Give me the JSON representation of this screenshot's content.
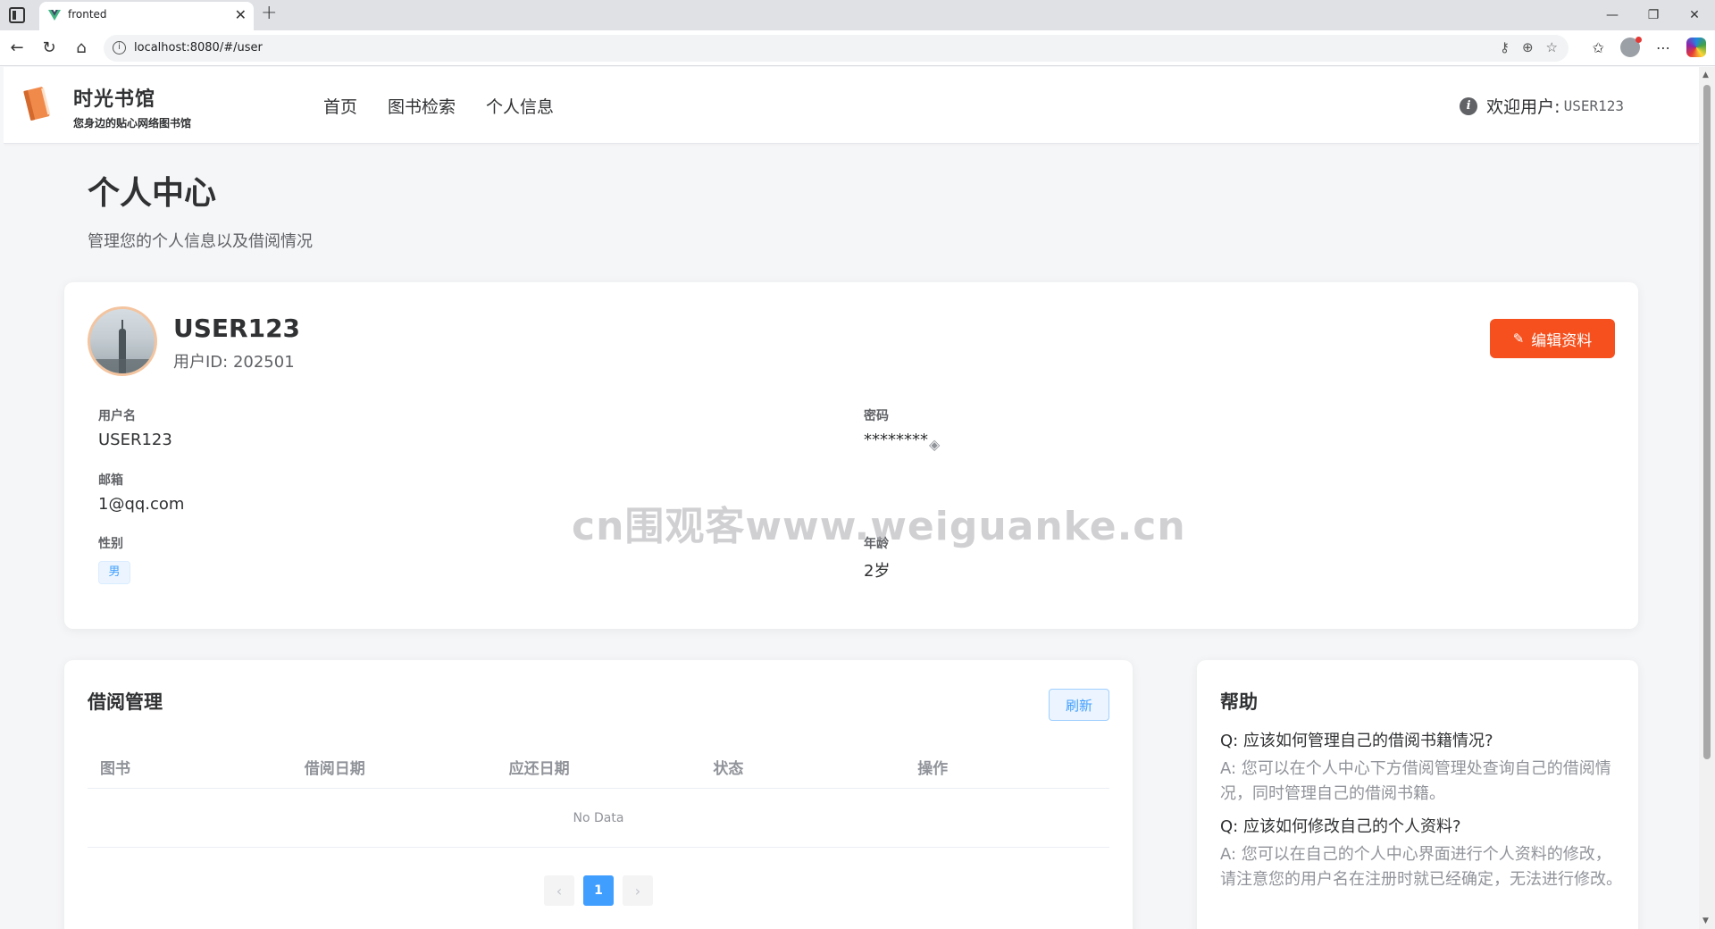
{
  "browser": {
    "tab_title": "fronted",
    "url": "localhost:8080/#/user"
  },
  "header": {
    "site_title": "时光书馆",
    "site_subtitle": "您身边的贴心网络图书馆",
    "nav": [
      {
        "label": "首页"
      },
      {
        "label": "图书检索"
      },
      {
        "label": "个人信息"
      }
    ],
    "welcome_label": "欢迎用户:",
    "welcome_user": "USER123"
  },
  "page": {
    "title": "个人中心",
    "subtitle": "管理您的个人信息以及借阅情况"
  },
  "profile": {
    "name": "USER123",
    "user_id": "用户ID: 202501",
    "edit_label": "编辑资料",
    "fields": {
      "username_label": "用户名",
      "username_value": "USER123",
      "password_label": "密码",
      "password_value": "********",
      "email_label": "邮箱",
      "email_value": "1@qq.com",
      "gender_label": "性别",
      "gender_value": "男",
      "age_label": "年龄",
      "age_value": "2岁"
    }
  },
  "borrow": {
    "title": "借阅管理",
    "refresh_label": "刷新",
    "columns": [
      "图书",
      "借阅日期",
      "应还日期",
      "状态",
      "操作"
    ],
    "empty_text": "No Data",
    "pagination": {
      "prev": "‹",
      "current": "1",
      "next": "›"
    }
  },
  "help": {
    "title": "帮助",
    "items": [
      {
        "q": "Q: 应该如何管理自己的借阅书籍情况?",
        "a": "A: 您可以在个人中心下方借阅管理处查询自己的借阅情况，同时管理自己的借阅书籍。"
      },
      {
        "q": "Q: 应该如何修改自己的个人资料?",
        "a": "A: 您可以在自己的个人中心界面进行个人资料的修改，请注意您的用户名在注册时就已经确定，无法进行修改。"
      }
    ]
  },
  "watermark": "cn围观客www.weiguanke.cn",
  "colors": {
    "accent_orange": "#f5501e",
    "primary_blue": "#409eff"
  }
}
